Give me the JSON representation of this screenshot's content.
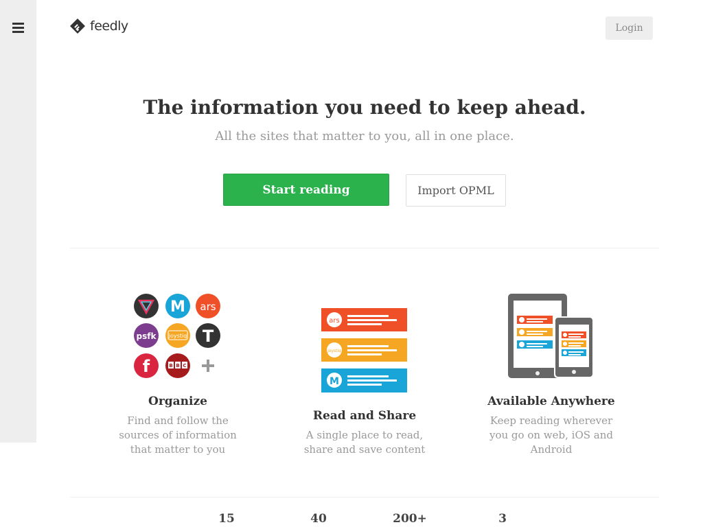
{
  "header": {
    "logo_text": "feedly",
    "login_label": "Login"
  },
  "hero": {
    "title": "The information you need to keep ahead.",
    "subtitle": "All the sites that matter to you, all in one place.",
    "primary_button": "Start reading",
    "secondary_button": "Import OPML"
  },
  "features": [
    {
      "title": "Organize",
      "description": [
        "Find and follow the",
        "sources of information",
        "that matter to you"
      ],
      "icons": [
        {
          "name": "verge-icon",
          "label": "",
          "color": "#333333"
        },
        {
          "name": "mashable-icon",
          "label": "M",
          "color": "#1aa5d8"
        },
        {
          "name": "ars-icon",
          "label": "ars",
          "color": "#f05028"
        },
        {
          "name": "psfk-icon",
          "label": "psfk",
          "color": "#7c3d8f"
        },
        {
          "name": "joystiq-icon",
          "label": "joystiq",
          "color": "#f5a623"
        },
        {
          "name": "nytimes-icon",
          "label": "T",
          "color": "#333333"
        },
        {
          "name": "fast-company-icon",
          "label": "f",
          "color": "#d9253f"
        },
        {
          "name": "bbc-icon",
          "label": "BBC",
          "color": "#a61c1c"
        },
        {
          "name": "plus-icon",
          "label": "+",
          "color": "#999999"
        }
      ]
    },
    {
      "title": "Read and Share",
      "description": [
        "A single place to read,",
        "share and save content"
      ],
      "cards": [
        {
          "name": "ars-card",
          "label": "ars",
          "color": "#f05028"
        },
        {
          "name": "joystiq-card",
          "label": "joystiq",
          "color": "#f5a623"
        },
        {
          "name": "mashable-card",
          "label": "M",
          "color": "#1aa5d8"
        }
      ]
    },
    {
      "title": "Available Anywhere",
      "description": [
        "Keep reading wherever",
        "you go on web, iOS and",
        "Android"
      ]
    }
  ],
  "stats": [
    "15",
    "40",
    "200+",
    "3"
  ],
  "colors": {
    "accent_green": "#2bb24c",
    "sidebar_bg": "#eeeeee",
    "muted_text": "#999999"
  }
}
